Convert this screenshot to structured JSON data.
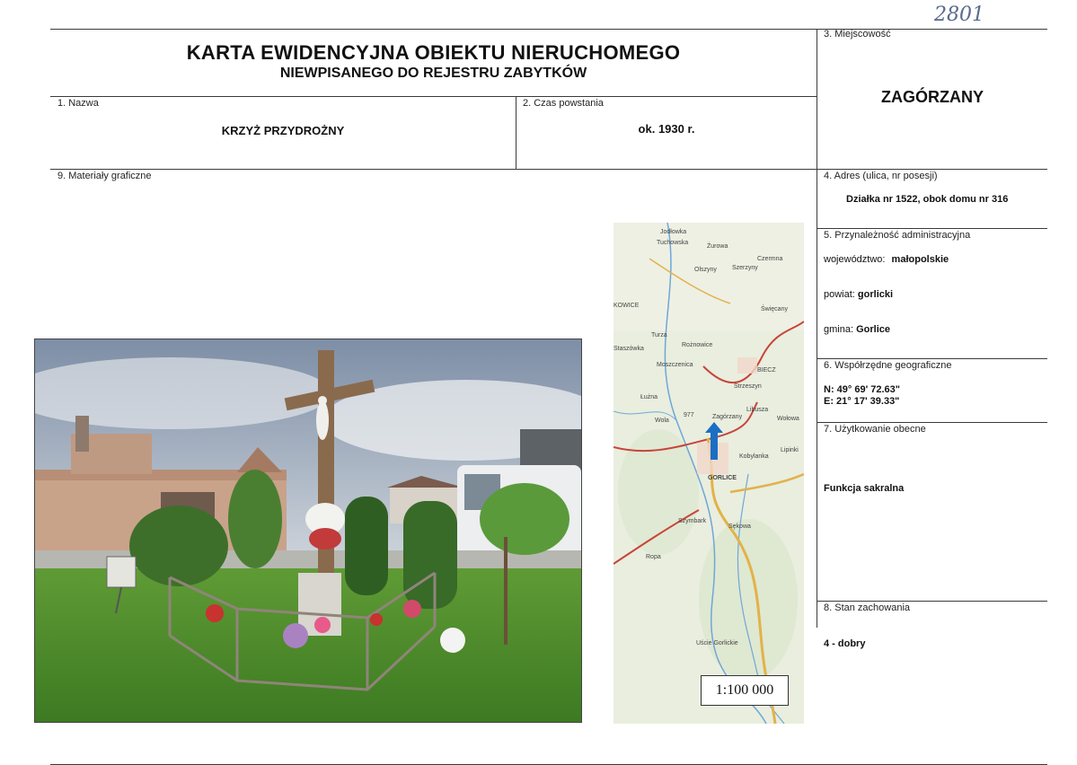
{
  "handwritten_number": "2801",
  "title": {
    "line1": "KARTA EWIDENCYJNA OBIEKTU NIERUCHOMEGO",
    "line2": "NIEWPISANEGO DO REJESTRU ZABYTKÓW"
  },
  "fields": {
    "name": {
      "label": "1. Nazwa",
      "value": "KRZYŻ PRZYDROŻNY"
    },
    "date": {
      "label": "2. Czas powstania",
      "value": "ok. 1930 r."
    },
    "locality": {
      "label": "3. Miejscowość",
      "value": "ZAGÓRZANY"
    },
    "address": {
      "label": "4. Adres (ulica, nr posesji)",
      "value": "Działka nr 1522, obok domu nr 316"
    },
    "admin": {
      "label": "5. Przynależność administracyjna",
      "voivodeship_label": "województwo:",
      "voivodeship": "małopolskie",
      "county_label": "powiat:",
      "county": "gorlicki",
      "commune_label": "gmina:",
      "commune": "Gorlice"
    },
    "coords": {
      "label": "6. Współrzędne geograficzne",
      "n": "N: 49° 69' 72.63\"",
      "e": "E: 21° 17' 39.33\""
    },
    "usage": {
      "label": "7. Użytkowanie obecne",
      "value": "Funkcja sakralna"
    },
    "condition": {
      "label": "8. Stan zachowania",
      "value": "4 - dobry"
    },
    "graphics": {
      "label": "9. Materiały graficzne"
    }
  },
  "map": {
    "scale": "1:100 000",
    "labels": {
      "jodlowka": "Jodłowka",
      "tuchowska": "Tuchowska",
      "zurowa": "Żurowa",
      "czermna": "Czermna",
      "olszyny": "Olszyny",
      "szerzyny": "Szerzyny",
      "kowice": "KOWICE",
      "turza": "Turza",
      "stasziowka": "Staszówka",
      "roznowice": "Rożnowice",
      "swiecany": "Święcany",
      "biecz": "BIECZ",
      "moszczenica": "Moszczenica",
      "strzeszyn": "Strzeszyn",
      "luzna": "Łużna",
      "zagorzany": "Zagórzany",
      "libusza": "Libusza",
      "wolowa": "Wołowa",
      "wola": "Wola",
      "lipinki": "Lipinki",
      "gorlice": "GORLICE",
      "kobylanka": "Kobylanka",
      "ropa": "Ropa",
      "szymbark": "Szymbark",
      "sekowa": "Sękowa",
      "usce": "Uście Gorlickie",
      "road_number": "977"
    },
    "colors": {
      "background": "#e9eedf",
      "road_main": "#e2b24a",
      "road_red": "#c8443a",
      "river": "#6fa7d6",
      "arrow": "#1a6fc4"
    }
  }
}
